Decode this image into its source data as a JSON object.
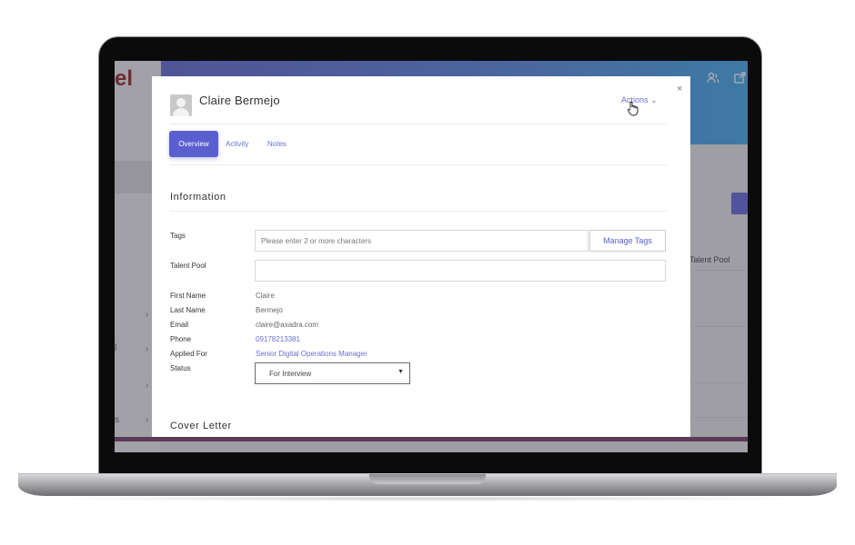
{
  "app": {
    "logo_text": "el",
    "sidebar_rows": [
      {
        "text": "",
        "chevron": "›"
      },
      {
        "text": "l",
        "chevron": "›"
      },
      {
        "text": "",
        "chevron": "›"
      },
      {
        "text": "s",
        "chevron": "›"
      }
    ],
    "header_icons": [
      "users-icon",
      "external-link-icon"
    ],
    "table_header": "Talent Pool"
  },
  "modal": {
    "candidate_name": "Claire Bermejo",
    "actions_label": "Actions ⌄",
    "close_label": "×",
    "tabs": [
      {
        "label": "Overview",
        "active": true
      },
      {
        "label": "Activity",
        "active": false
      },
      {
        "label": "Notes",
        "active": false
      }
    ],
    "information_title": "Information",
    "tags": {
      "label": "Tags",
      "placeholder": "Please enter 2 or more characters",
      "manage_button": "Manage Tags"
    },
    "talent_pool": {
      "label": "Talent Pool",
      "value": ""
    },
    "fields": [
      {
        "label": "First Name",
        "value": "Claire",
        "link": false
      },
      {
        "label": "Last Name",
        "value": "Bermejo",
        "link": false
      },
      {
        "label": "Email",
        "value": "claire@axadra.com",
        "link": false
      },
      {
        "label": "Phone",
        "value": "09178213381",
        "link": true
      },
      {
        "label": "Applied For",
        "value": "Senior Digital Operations Manager",
        "link": true
      }
    ],
    "status": {
      "label": "Status",
      "value": "For Interview"
    },
    "cover_letter_title": "Cover Letter"
  },
  "colors": {
    "accent": "#5a5fd0",
    "header_start": "#5a5fc8",
    "header_end": "#3aa0e0"
  }
}
